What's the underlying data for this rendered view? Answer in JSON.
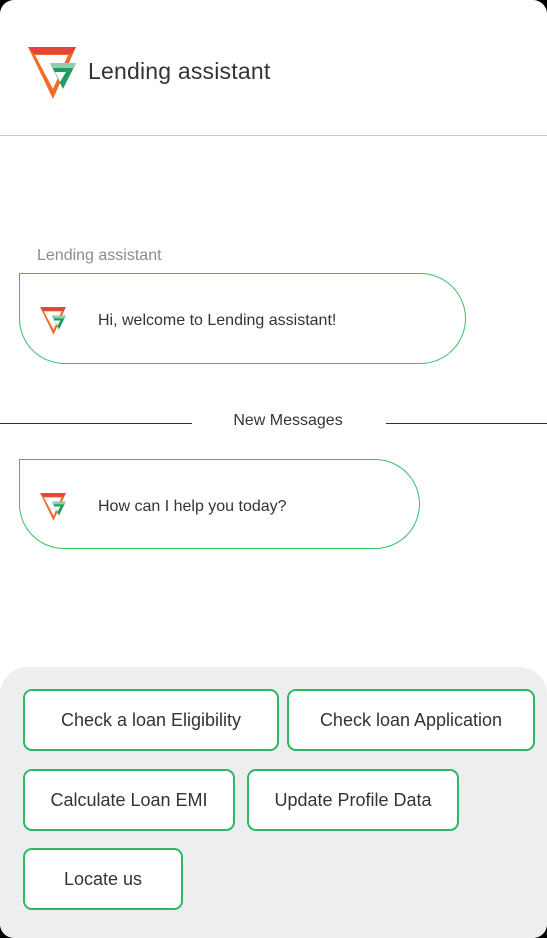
{
  "header": {
    "title": "Lending assistant",
    "logo_icon": "lending-logo-icon"
  },
  "chat": {
    "sender_label": "Lending assistant",
    "messages": [
      {
        "text": "Hi, welcome to Lending assistant!"
      },
      {
        "text": "How can I help you today?"
      }
    ],
    "divider_label": "New Messages"
  },
  "quick_replies": [
    {
      "label": "Check a loan Eligibility"
    },
    {
      "label": "Check loan Application"
    },
    {
      "label": "Calculate Loan EMI"
    },
    {
      "label": "Update Profile Data"
    },
    {
      "label": "Locate us"
    }
  ],
  "colors": {
    "accent": "#2db866",
    "logo_orange": "#f26b2a",
    "logo_red": "#e23b3b",
    "logo_green": "#1e9e5e",
    "panel": "#eeeeee"
  }
}
